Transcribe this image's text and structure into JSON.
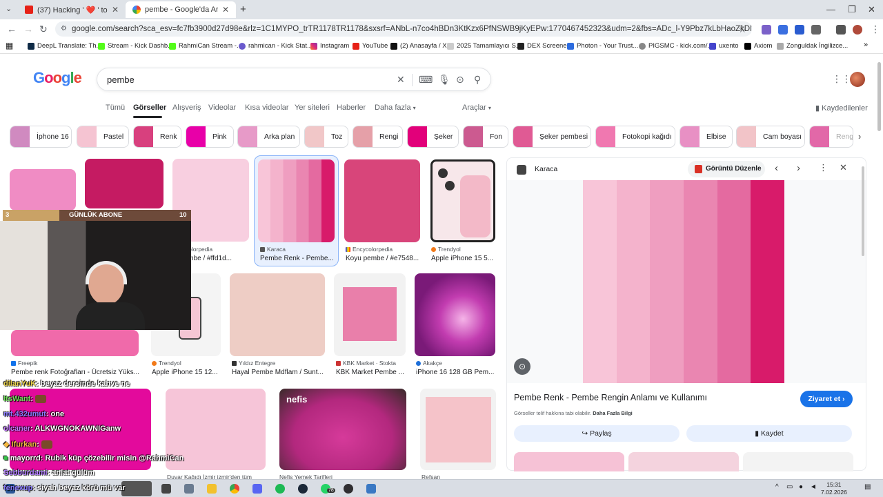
{
  "browser": {
    "tabs": [
      {
        "title": "(37) Hacking ' ❤️ ' to Track ANY",
        "active": false
      },
      {
        "title": "pembe - Google'da Ara",
        "active": true
      }
    ],
    "new_tab": "+",
    "url": "google.com/search?sca_esv=fc7fb3900d27d98e&rlz=1C1MYPO_trTR1178TR1178&sxsrf=ANbL-n7co4hBDn3KtKzx6PfNSWB9jKyEPw:1770467452323&udm=2&fbs=ADc_l-Y9Pbz7kLbHaoZkDNm-44bHmAj9aGUCfWT0UmgtvHQtBUA0...",
    "bookmarks": [
      "DeepL Translate: Th...",
      "Stream - Kick Dashb...",
      "RahmiCan Stream -...",
      "rahmican - Kick Stat...",
      "Instagram",
      "YouTube",
      "(2) Anasayfa / X",
      "2025 Tamamlayıcı S...",
      "DEX Screener",
      "Photon - Your Trust...",
      "PIGSMC - kick.com/...",
      "uxento",
      "Axiom",
      "Zonguldak İngilizce..."
    ]
  },
  "google": {
    "logo": "Google",
    "query": "pembe",
    "tabs": [
      "Tümü",
      "Görseller",
      "Alışveriş",
      "Videolar",
      "Kısa videolar",
      "Yer siteleri",
      "Haberler",
      "Daha fazla",
      "Araçlar"
    ],
    "saved": "Kaydedilenler",
    "chips": [
      "İphone 16",
      "Pastel",
      "Renk",
      "Pink",
      "Arka plan",
      "Toz",
      "Rengi",
      "Şeker",
      "Fon",
      "Şeker pembesi",
      "Fotokopi kağıdı",
      "Elbise",
      "Cam boyası",
      "Rengi"
    ]
  },
  "results": [
    {
      "source": "Encycolorpedia",
      "title": "... pembe / #ffd1d..."
    },
    {
      "source": "Karaca",
      "title": "Pembe Renk - Pembe..."
    },
    {
      "source": "Encycolorpedia",
      "title": "Koyu pembe / #e7548..."
    },
    {
      "source": "Trendyol",
      "title": "Apple iPhone 15 5..."
    },
    {
      "source": "Freepik",
      "title": "Pembe renk Fotoğrafları - Ücretsiz Yüks..."
    },
    {
      "source": "Trendyol",
      "title": "Apple iPhone 15 12..."
    },
    {
      "source": "Yıldız Entegre",
      "title": "Hayal Pembe Mdflam / Sunt..."
    },
    {
      "source": "KBK Market · Stokta",
      "title": "KBK Market Pembe ..."
    },
    {
      "source": "Akakçe",
      "title": "iPhone 16 128 GB Pem..."
    },
    {
      "source": "Duvar Kağıdı İzmir izmir'den tüm",
      "title": ""
    },
    {
      "source": "Nefis Yemek Tarifleri",
      "title": ""
    },
    {
      "source": "Refsan",
      "title": ""
    }
  ],
  "panel": {
    "source": "Karaca",
    "edit_button": "Görüntü Düzenle",
    "title": "Pembe Renk - Pembe Rengin Anlamı ve Kullanımı",
    "visit": "Ziyaret et",
    "notice": "Görseller telif hakkına tabi olabilir.",
    "more_info": "Daha Fazla Bilgi",
    "share": "Paylaş",
    "save": "Kaydet"
  },
  "stream": {
    "abone_label": "GÜNLÜK ABONE",
    "abone_left": "3",
    "abone_right": "10",
    "chat": [
      {
        "user": "dilanYuK",
        "msg": ": beyaz dersinde kahve ne"
      },
      {
        "user": "ItsWant",
        "msg": ": "
      },
      {
        "user": "mt.432umut",
        "msg": ": one"
      },
      {
        "user": "olcaner",
        "msg": ": ALKWGNOKAWNIGanw"
      },
      {
        "user": "Ifurkan",
        "msg": ": "
      },
      {
        "user": "mayorrd",
        "msg": ": Rubik küp çözebilir misin @RahmiCan"
      },
      {
        "user": "Sebburdami",
        "msg": ": anlat gülüm"
      },
      {
        "user": "fenexup",
        "msg": ": siyah beyaz körü mü var"
      }
    ]
  },
  "taskbar": {
    "time": "15:31",
    "date": "7.02.2026",
    "badge": "78"
  },
  "colors": {
    "accent": "#1a73e8",
    "pink_strip": [
      "#f8c5d8",
      "#f4b3cc",
      "#ef9ec0",
      "#ea86b1",
      "#e46aa0",
      "#d81b6a"
    ]
  }
}
